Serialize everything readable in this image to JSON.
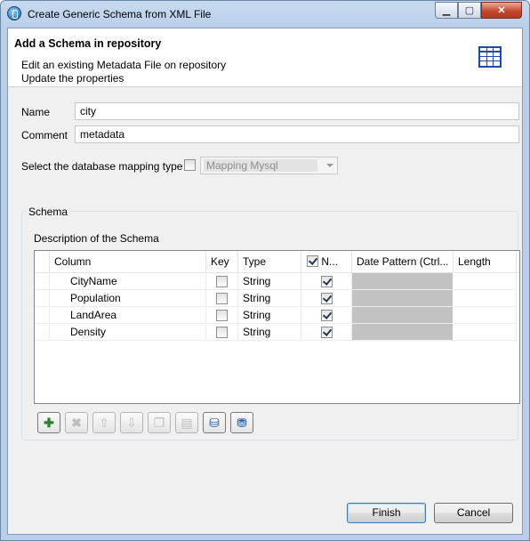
{
  "window": {
    "title": "Create Generic Schema from XML File"
  },
  "header": {
    "title": "Add a Schema in repository",
    "line1": "Edit an existing Metadata File on repository",
    "line2": "Update the properties"
  },
  "form": {
    "name_label": "Name",
    "name_value": "city",
    "comment_label": "Comment",
    "comment_value": "metadata",
    "mapping_label": "Select the database mapping type",
    "mapping_checked": false,
    "mapping_value": "Mapping Mysql"
  },
  "schema": {
    "group_title": "Schema",
    "description": "Description of the Schema",
    "columns": [
      "Column",
      "Key",
      "Type",
      "N...",
      "Date Pattern (Ctrl...",
      "Length"
    ],
    "rows": [
      {
        "column": "CityName",
        "key": false,
        "type": "String",
        "nullable": true
      },
      {
        "column": "Population",
        "key": false,
        "type": "String",
        "nullable": true
      },
      {
        "column": "LandArea",
        "key": false,
        "type": "String",
        "nullable": true
      },
      {
        "column": "Density",
        "key": false,
        "type": "String",
        "nullable": true
      }
    ],
    "toolbar": [
      {
        "icon": "add-icon",
        "enabled": true
      },
      {
        "icon": "remove-icon",
        "enabled": false
      },
      {
        "icon": "move-up-icon",
        "enabled": false
      },
      {
        "icon": "move-down-icon",
        "enabled": false
      },
      {
        "icon": "copy-icon",
        "enabled": false
      },
      {
        "icon": "paste-icon",
        "enabled": false
      },
      {
        "icon": "import-schema-icon",
        "enabled": true
      },
      {
        "icon": "export-schema-icon",
        "enabled": true
      }
    ]
  },
  "buttons": {
    "finish": "Finish",
    "cancel": "Cancel"
  }
}
